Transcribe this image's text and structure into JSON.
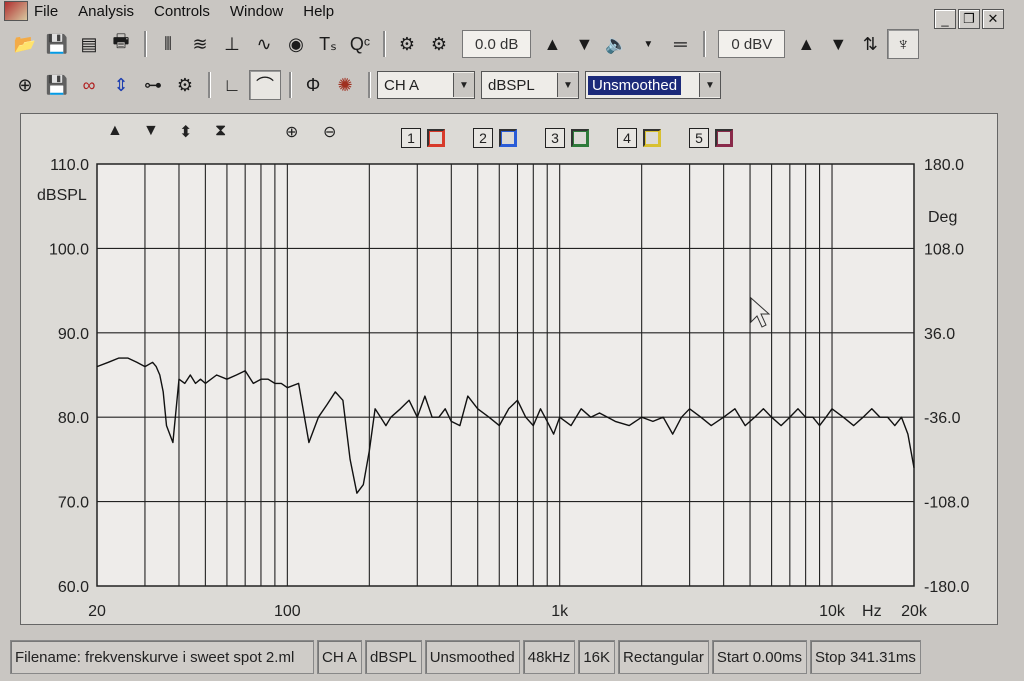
{
  "menu": {
    "file": "File",
    "analysis": "Analysis",
    "controls": "Controls",
    "window": "Window",
    "help": "Help"
  },
  "window_controls": {
    "minimize": "_",
    "restore": "❐",
    "close": "✕"
  },
  "toolbar": {
    "gain_readout": "0.0 dB",
    "level_readout": "0 dBV",
    "ts_label": "Tₛ",
    "qc_label": "Qᶜ"
  },
  "toolbar2": {
    "channel_select": "CH A",
    "units_select": "dBSPL",
    "smoothing_select": "Unsmoothed"
  },
  "traces": [
    {
      "num": "1",
      "color": "#d83a2a"
    },
    {
      "num": "2",
      "color": "#2a5cd8"
    },
    {
      "num": "3",
      "color": "#2e7a3a"
    },
    {
      "num": "4",
      "color": "#d8c030"
    },
    {
      "num": "5",
      "color": "#8a2a4a"
    }
  ],
  "chart_data": {
    "type": "line",
    "xscale": "log",
    "xlim": [
      20,
      20000
    ],
    "ylim": [
      60,
      110
    ],
    "y2lim": [
      -180,
      180
    ],
    "ylabel": "dBSPL",
    "y2label": "Deg",
    "xunit": "Hz",
    "yticks": [
      "110.0",
      "100.0",
      "90.0",
      "80.0",
      "70.0",
      "60.0"
    ],
    "y2ticks": [
      "180.0",
      "108.0",
      "36.0",
      "-36.0",
      "-108.0",
      "-180.0"
    ],
    "xticks": [
      {
        "value": 20,
        "label": "20"
      },
      {
        "value": 100,
        "label": "100"
      },
      {
        "value": 1000,
        "label": "1k"
      },
      {
        "value": 10000,
        "label": "10k"
      },
      {
        "value": 20000,
        "label": "20k"
      }
    ],
    "grid": true,
    "series": [
      {
        "color": "#111111",
        "x": [
          20,
          22,
          24,
          26,
          28,
          30,
          32,
          33,
          34,
          35,
          36,
          38,
          40,
          42,
          44,
          46,
          48,
          50,
          55,
          60,
          65,
          70,
          75,
          80,
          85,
          90,
          95,
          100,
          110,
          120,
          130,
          140,
          150,
          160,
          170,
          180,
          190,
          200,
          210,
          220,
          230,
          240,
          260,
          280,
          300,
          320,
          340,
          360,
          380,
          400,
          430,
          460,
          500,
          550,
          600,
          650,
          700,
          750,
          800,
          850,
          900,
          950,
          1000,
          1100,
          1200,
          1300,
          1400,
          1500,
          1600,
          1800,
          2000,
          2200,
          2400,
          2600,
          2800,
          3000,
          3300,
          3600,
          4000,
          4400,
          4800,
          5200,
          5600,
          6000,
          6500,
          7000,
          7500,
          8000,
          8500,
          9000,
          9500,
          10000,
          11000,
          12000,
          13000,
          14000,
          15000,
          16000,
          17000,
          18000,
          19000,
          20000
        ],
        "y": [
          86,
          86.5,
          87,
          87,
          86.5,
          86,
          86.5,
          86,
          85,
          83,
          79,
          77,
          84.5,
          84,
          85,
          84,
          84.5,
          84,
          85,
          84.5,
          85,
          85.5,
          84,
          84.5,
          84.5,
          84,
          84,
          83.5,
          84,
          77,
          80,
          81.5,
          83,
          82,
          75,
          71,
          72,
          76,
          81,
          80,
          79,
          80,
          81,
          82,
          80,
          82.5,
          80,
          80,
          81,
          79.5,
          79,
          82.5,
          81,
          80,
          79,
          81,
          82,
          80,
          79,
          81,
          79.5,
          78,
          80,
          79,
          81,
          80,
          80.5,
          80,
          79.5,
          79,
          80,
          79.5,
          80,
          78,
          80,
          81,
          80,
          79,
          80,
          81,
          79,
          80,
          81,
          80,
          79,
          80,
          81,
          80,
          80,
          79,
          80,
          81,
          80,
          79,
          80,
          81,
          80,
          80,
          79,
          80,
          78,
          74
        ]
      }
    ]
  },
  "status": {
    "filename": "Filename: frekvenskurve i sweet spot 2.ml",
    "channel": "CH A",
    "units": "dBSPL",
    "smoothing": "Unsmoothed",
    "rate": "48kHz",
    "fft_size": "16K",
    "window": "Rectangular",
    "start": "Start 0.00ms",
    "stop": "Stop 341.31ms"
  }
}
